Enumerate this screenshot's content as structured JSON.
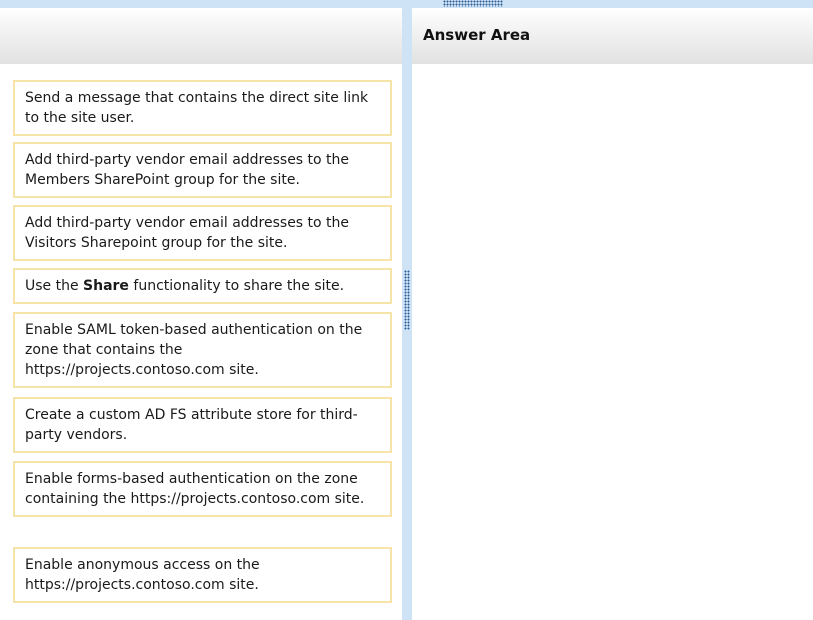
{
  "answer_area": {
    "title": "Answer Area"
  },
  "choices": [
    {
      "text": "Send a message that contains the direct site link to the site user."
    },
    {
      "text": "Add third-party vendor email addresses to the Members SharePoint group for the site."
    },
    {
      "text": "Add third-party vendor email addresses to the Visitors Sharepoint group for the site."
    },
    {
      "text_before": "Use the ",
      "text_bold": "Share",
      "text_after": " functionality to share the site."
    },
    {
      "text": "Enable SAML token-based authentication on the zone that contains the https://projects.contoso.com site."
    },
    {
      "text": "Create a custom AD FS attribute store for third-party vendors."
    },
    {
      "text": "Enable forms-based authentication on the zone containing the https://projects.contoso.com site."
    },
    {
      "text": "Enable anonymous access on the https://projects.contoso.com site."
    }
  ],
  "colors": {
    "accent_bar": "#cfe3f7",
    "grip_dots": "#2f5f95",
    "choice_border": "#f5e3a8"
  }
}
